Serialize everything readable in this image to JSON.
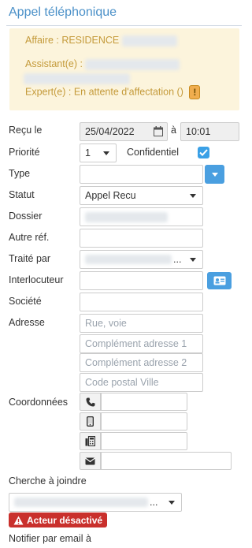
{
  "header": {
    "title": "Appel téléphonique"
  },
  "info": {
    "affaire_label": "Affaire : RESIDENCE",
    "assistant_label": "Assistant(e) :",
    "expert_label": "Expert(e) : En attente d'affectation ()",
    "expert_badge": "!"
  },
  "form": {
    "recu_le": {
      "label": "Reçu le",
      "date": "25/04/2022",
      "separator": "à",
      "time": "10:01"
    },
    "priorite": {
      "label": "Priorité",
      "value": "1",
      "confidentiel_label": "Confidentiel",
      "confidentiel_checked": true
    },
    "type": {
      "label": "Type",
      "value": ""
    },
    "statut": {
      "label": "Statut",
      "value": "Appel Recu"
    },
    "dossier": {
      "label": "Dossier"
    },
    "autre_ref": {
      "label": "Autre réf.",
      "value": ""
    },
    "traite_par": {
      "label": "Traité par",
      "suffix": "..."
    },
    "interlocuteur": {
      "label": "Interlocuteur",
      "value": ""
    },
    "societe": {
      "label": "Société",
      "value": ""
    },
    "adresse": {
      "label": "Adresse",
      "street_placeholder": "Rue, voie",
      "complement1_placeholder": "Complément adresse 1",
      "complement2_placeholder": "Complément adresse 2",
      "postal_placeholder": "Code postal Ville"
    },
    "coordonnees": {
      "label": "Coordonnées"
    },
    "cherche_a_joindre": {
      "label": "Cherche à joindre",
      "suffix": "..."
    },
    "acteur_desactive": "Acteur désactivé",
    "notifier_label": "Notifier par email à"
  },
  "colors": {
    "accent": "#4a90c8",
    "info_bg": "#fcf4dc",
    "info_text": "#c49a3a",
    "danger": "#c9302c",
    "button": "#4a9fe0"
  }
}
